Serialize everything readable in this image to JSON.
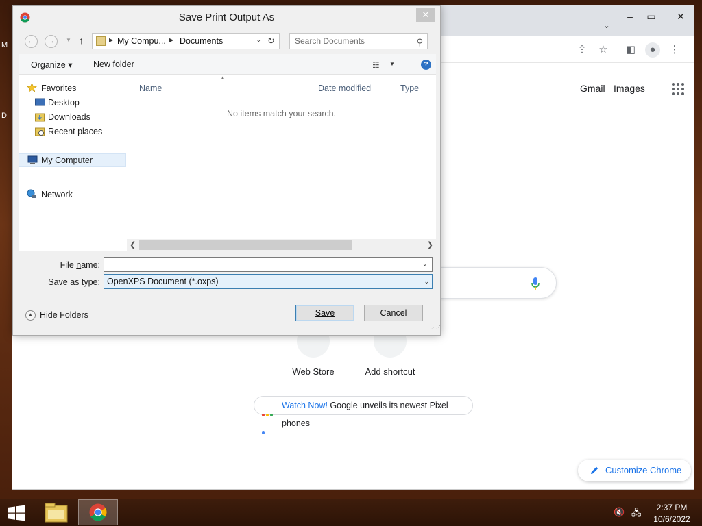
{
  "dialog": {
    "title": "Save Print Output As",
    "close_label": "✕",
    "address": {
      "segments": [
        "My Compu...",
        "Documents"
      ]
    },
    "search_placeholder": "Search Documents",
    "toolbar": {
      "organize_label": "Organize ▾",
      "new_folder_label": "New folder"
    },
    "nav_pane": {
      "favorites_label": "Favorites",
      "favorites_items": [
        "Desktop",
        "Downloads",
        "Recent places"
      ],
      "my_computer_label": "My Computer",
      "network_label": "Network"
    },
    "columns": [
      "Name",
      "Date modified",
      "Type"
    ],
    "empty_message": "No items match your search.",
    "file_name": {
      "value": "",
      "placeholder": ""
    },
    "save_as_type": "OpenXPS Document (*.oxps)",
    "hide_folders_label": "Hide Folders",
    "save_label": "Save",
    "cancel_label": "Cancel"
  },
  "chrome": {
    "links": {
      "gmail": "Gmail",
      "images": "Images"
    },
    "shortcuts": [
      "Web Store",
      "Add shortcut"
    ],
    "promo": {
      "link_text": "Watch Now!",
      "text": " Google unveils its newest Pixel phones"
    },
    "customize_label": "Customize Chrome"
  },
  "taskbar": {
    "time": "2:37 PM",
    "date": "10/6/2022"
  },
  "colors": {
    "accent_blue": "#1a73e8",
    "selection_bg": "#e5f1fb",
    "button_border": "#3c7fb1"
  }
}
